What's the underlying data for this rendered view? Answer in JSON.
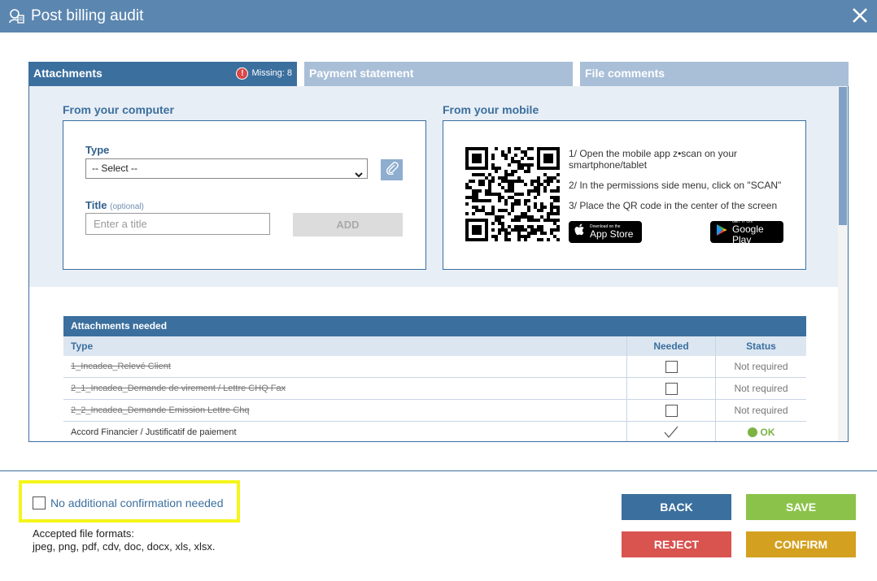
{
  "header": {
    "title": "Post billing audit",
    "title_icon": "audit-icon",
    "close_icon": "close-icon"
  },
  "tabs": [
    {
      "label": "Attachments",
      "active": true,
      "missing_label": "Missing: 8"
    },
    {
      "label": "Payment statement",
      "active": false
    },
    {
      "label": "File comments",
      "active": false
    }
  ],
  "computer": {
    "title": "From your computer",
    "type_label": "Type",
    "type_value": "-- Select --",
    "title_label": "Title",
    "title_optional": "(optional)",
    "title_placeholder": "Enter a title",
    "add_label": "ADD"
  },
  "mobile": {
    "title": "From your mobile",
    "step1": "1/ Open the mobile app z•scan on your smartphone/tablet",
    "step2": "2/ In the permissions side menu, click on \"SCAN\"",
    "step3": "3/ Place the QR code in the center of the screen",
    "appstore_small": "Download on the",
    "appstore_big": "App Store",
    "googleplay_small": "GET IT ON",
    "googleplay_big": "Google Play"
  },
  "table": {
    "title": "Attachments needed",
    "columns": [
      "Type",
      "Needed",
      "Status"
    ],
    "rows": [
      {
        "type": "1_Incadea_Relevé Client",
        "needed": false,
        "status": "Not required",
        "strike": true
      },
      {
        "type": "2_1_Incadea_Demande de virement / Lettre CHQ Fax",
        "needed": false,
        "status": "Not required",
        "strike": true
      },
      {
        "type": "2_2_Incadea_Demande Emission Lettre Chq",
        "needed": false,
        "status": "Not required",
        "strike": true
      },
      {
        "type": "Accord Financier / Justificatif de paiement",
        "needed": true,
        "status": "OK",
        "strike": false
      }
    ]
  },
  "footer": {
    "confirmation_label": "No additional confirmation needed",
    "formats_title": "Accepted file formats:",
    "formats_list": "jpeg, png, pdf, cdv, doc, docx, xls, xlsx.",
    "back_label": "BACK",
    "save_label": "SAVE",
    "reject_label": "REJECT",
    "confirm_label": "CONFIRM"
  },
  "colors": {
    "header": "#5b86b0",
    "primary": "#3b6f9e",
    "save": "#8bc34a",
    "reject": "#d9534f",
    "confirm": "#d4a020",
    "highlight": "#f5f51a"
  }
}
